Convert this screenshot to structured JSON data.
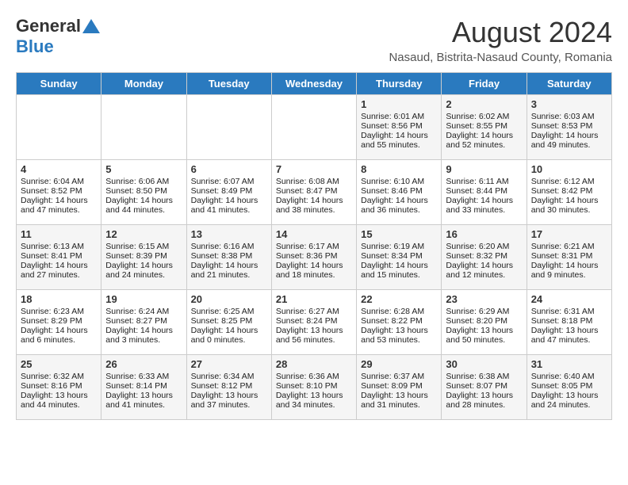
{
  "header": {
    "logo_general": "General",
    "logo_blue": "Blue",
    "month": "August 2024",
    "location": "Nasaud, Bistrita-Nasaud County, Romania"
  },
  "days_of_week": [
    "Sunday",
    "Monday",
    "Tuesday",
    "Wednesday",
    "Thursday",
    "Friday",
    "Saturday"
  ],
  "weeks": [
    [
      {
        "day": "",
        "content": ""
      },
      {
        "day": "",
        "content": ""
      },
      {
        "day": "",
        "content": ""
      },
      {
        "day": "",
        "content": ""
      },
      {
        "day": "1",
        "content": "Sunrise: 6:01 AM\nSunset: 8:56 PM\nDaylight: 14 hours\nand 55 minutes."
      },
      {
        "day": "2",
        "content": "Sunrise: 6:02 AM\nSunset: 8:55 PM\nDaylight: 14 hours\nand 52 minutes."
      },
      {
        "day": "3",
        "content": "Sunrise: 6:03 AM\nSunset: 8:53 PM\nDaylight: 14 hours\nand 49 minutes."
      }
    ],
    [
      {
        "day": "4",
        "content": "Sunrise: 6:04 AM\nSunset: 8:52 PM\nDaylight: 14 hours\nand 47 minutes."
      },
      {
        "day": "5",
        "content": "Sunrise: 6:06 AM\nSunset: 8:50 PM\nDaylight: 14 hours\nand 44 minutes."
      },
      {
        "day": "6",
        "content": "Sunrise: 6:07 AM\nSunset: 8:49 PM\nDaylight: 14 hours\nand 41 minutes."
      },
      {
        "day": "7",
        "content": "Sunrise: 6:08 AM\nSunset: 8:47 PM\nDaylight: 14 hours\nand 38 minutes."
      },
      {
        "day": "8",
        "content": "Sunrise: 6:10 AM\nSunset: 8:46 PM\nDaylight: 14 hours\nand 36 minutes."
      },
      {
        "day": "9",
        "content": "Sunrise: 6:11 AM\nSunset: 8:44 PM\nDaylight: 14 hours\nand 33 minutes."
      },
      {
        "day": "10",
        "content": "Sunrise: 6:12 AM\nSunset: 8:42 PM\nDaylight: 14 hours\nand 30 minutes."
      }
    ],
    [
      {
        "day": "11",
        "content": "Sunrise: 6:13 AM\nSunset: 8:41 PM\nDaylight: 14 hours\nand 27 minutes."
      },
      {
        "day": "12",
        "content": "Sunrise: 6:15 AM\nSunset: 8:39 PM\nDaylight: 14 hours\nand 24 minutes."
      },
      {
        "day": "13",
        "content": "Sunrise: 6:16 AM\nSunset: 8:38 PM\nDaylight: 14 hours\nand 21 minutes."
      },
      {
        "day": "14",
        "content": "Sunrise: 6:17 AM\nSunset: 8:36 PM\nDaylight: 14 hours\nand 18 minutes."
      },
      {
        "day": "15",
        "content": "Sunrise: 6:19 AM\nSunset: 8:34 PM\nDaylight: 14 hours\nand 15 minutes."
      },
      {
        "day": "16",
        "content": "Sunrise: 6:20 AM\nSunset: 8:32 PM\nDaylight: 14 hours\nand 12 minutes."
      },
      {
        "day": "17",
        "content": "Sunrise: 6:21 AM\nSunset: 8:31 PM\nDaylight: 14 hours\nand 9 minutes."
      }
    ],
    [
      {
        "day": "18",
        "content": "Sunrise: 6:23 AM\nSunset: 8:29 PM\nDaylight: 14 hours\nand 6 minutes."
      },
      {
        "day": "19",
        "content": "Sunrise: 6:24 AM\nSunset: 8:27 PM\nDaylight: 14 hours\nand 3 minutes."
      },
      {
        "day": "20",
        "content": "Sunrise: 6:25 AM\nSunset: 8:25 PM\nDaylight: 14 hours and 0 minutes."
      },
      {
        "day": "21",
        "content": "Sunrise: 6:27 AM\nSunset: 8:24 PM\nDaylight: 13 hours\nand 56 minutes."
      },
      {
        "day": "22",
        "content": "Sunrise: 6:28 AM\nSunset: 8:22 PM\nDaylight: 13 hours\nand 53 minutes."
      },
      {
        "day": "23",
        "content": "Sunrise: 6:29 AM\nSunset: 8:20 PM\nDaylight: 13 hours\nand 50 minutes."
      },
      {
        "day": "24",
        "content": "Sunrise: 6:31 AM\nSunset: 8:18 PM\nDaylight: 13 hours\nand 47 minutes."
      }
    ],
    [
      {
        "day": "25",
        "content": "Sunrise: 6:32 AM\nSunset: 8:16 PM\nDaylight: 13 hours\nand 44 minutes."
      },
      {
        "day": "26",
        "content": "Sunrise: 6:33 AM\nSunset: 8:14 PM\nDaylight: 13 hours\nand 41 minutes."
      },
      {
        "day": "27",
        "content": "Sunrise: 6:34 AM\nSunset: 8:12 PM\nDaylight: 13 hours\nand 37 minutes."
      },
      {
        "day": "28",
        "content": "Sunrise: 6:36 AM\nSunset: 8:10 PM\nDaylight: 13 hours\nand 34 minutes."
      },
      {
        "day": "29",
        "content": "Sunrise: 6:37 AM\nSunset: 8:09 PM\nDaylight: 13 hours\nand 31 minutes."
      },
      {
        "day": "30",
        "content": "Sunrise: 6:38 AM\nSunset: 8:07 PM\nDaylight: 13 hours\nand 28 minutes."
      },
      {
        "day": "31",
        "content": "Sunrise: 6:40 AM\nSunset: 8:05 PM\nDaylight: 13 hours\nand 24 minutes."
      }
    ]
  ]
}
